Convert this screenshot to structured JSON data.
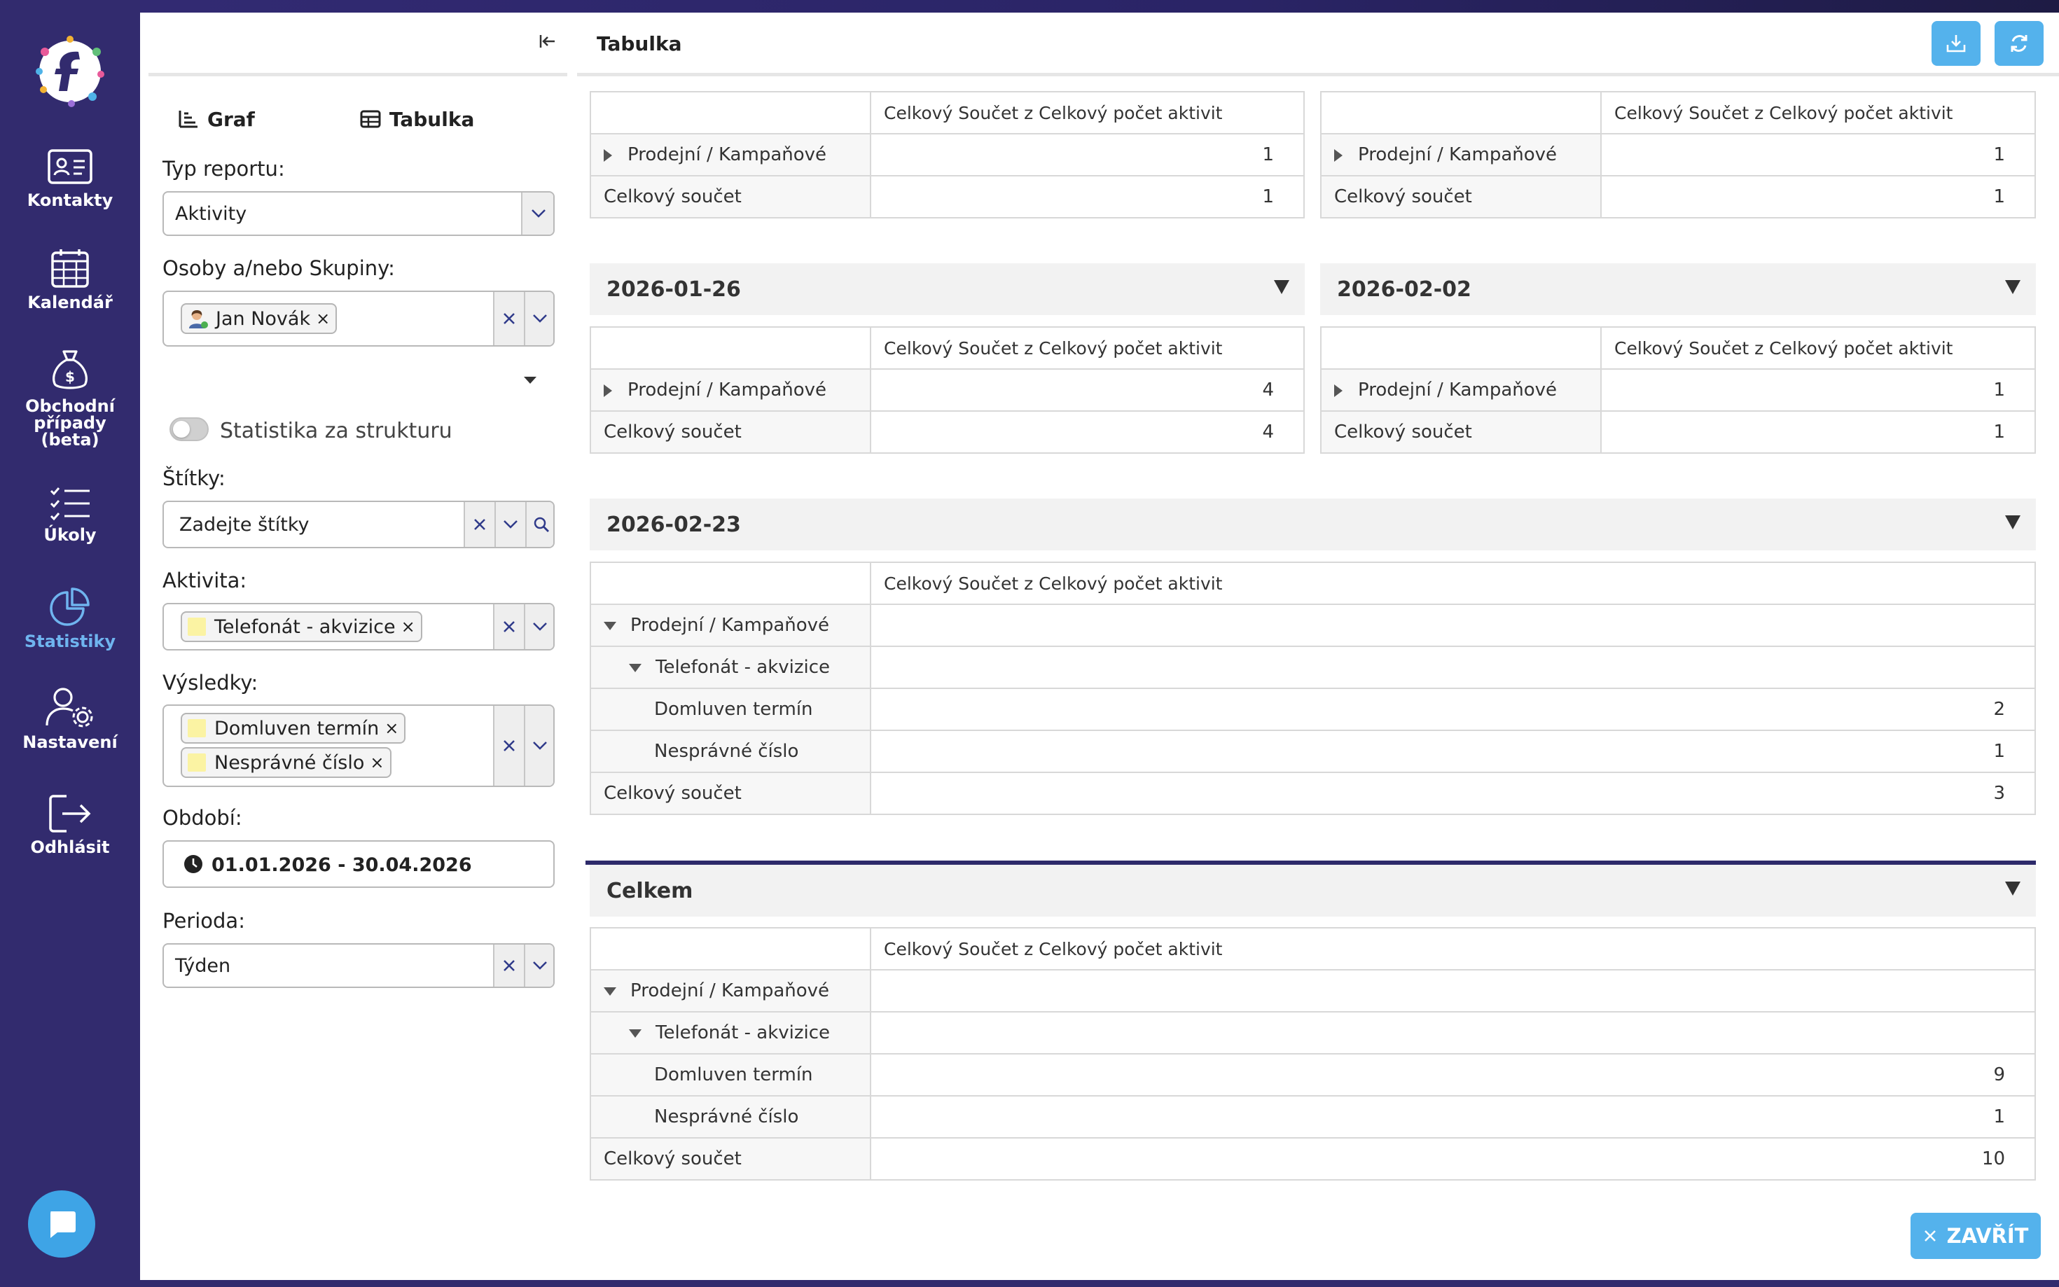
{
  "nav": {
    "items": [
      {
        "label": "Kontakty",
        "icon": "contact-card-icon"
      },
      {
        "label": "Kalendář",
        "icon": "calendar-icon"
      },
      {
        "label": "Obchodní případy (beta)",
        "icon": "money-bag-icon"
      },
      {
        "label": "Úkoly",
        "icon": "task-list-icon"
      },
      {
        "label": "Statistiky",
        "icon": "pie-chart-icon",
        "active": true
      },
      {
        "label": "Nastavení",
        "icon": "user-gear-icon"
      },
      {
        "label": "Odhlásit",
        "icon": "logout-icon"
      }
    ]
  },
  "sidebar": {
    "mode_graph": "Graf",
    "mode_table": "Tabulka",
    "report_type_label": "Typ reportu:",
    "report_type_value": "Aktivity",
    "persons_label": "Osoby a/nebo Skupiny:",
    "person_chip": "Jan Novák",
    "structure_toggle_label": "Statistika za strukturu",
    "tags_label": "Štítky:",
    "tags_placeholder": "Zadejte štítky",
    "activity_label": "Aktivita:",
    "activity_chip": "Telefonát - akvizice",
    "results_label": "Výsledky:",
    "result_chips": [
      "Domluven termín",
      "Nesprávné číslo"
    ],
    "period_label": "Období:",
    "period_value": "01.01.2026 - 30.04.2026",
    "perioda_label": "Perioda:",
    "perioda_value": "Týden"
  },
  "content": {
    "title": "Tabulka",
    "col_header": "Celkový Součet z Celkový počet aktivit",
    "row_category": "Prodejní / Kampaňové",
    "row_activity": "Telefonát - akvizice",
    "row_result_1": "Domluven termín",
    "row_result_2": "Nesprávné číslo",
    "row_total": "Celkový součet",
    "tables": {
      "top_left": {
        "category": 1,
        "total": 1
      },
      "top_right": {
        "category": 1,
        "total": 1
      },
      "w0126": {
        "date": "2026-01-26",
        "category": 4,
        "total": 4
      },
      "w0202": {
        "date": "2026-02-02",
        "category": 1,
        "total": 1
      },
      "w0223": {
        "date": "2026-02-23",
        "result_1": 2,
        "result_2": 1,
        "total": 3
      },
      "summary": {
        "title": "Celkem",
        "result_1": 9,
        "result_2": 1,
        "total": 10
      }
    },
    "close_label": "ZAVŘÍT"
  }
}
